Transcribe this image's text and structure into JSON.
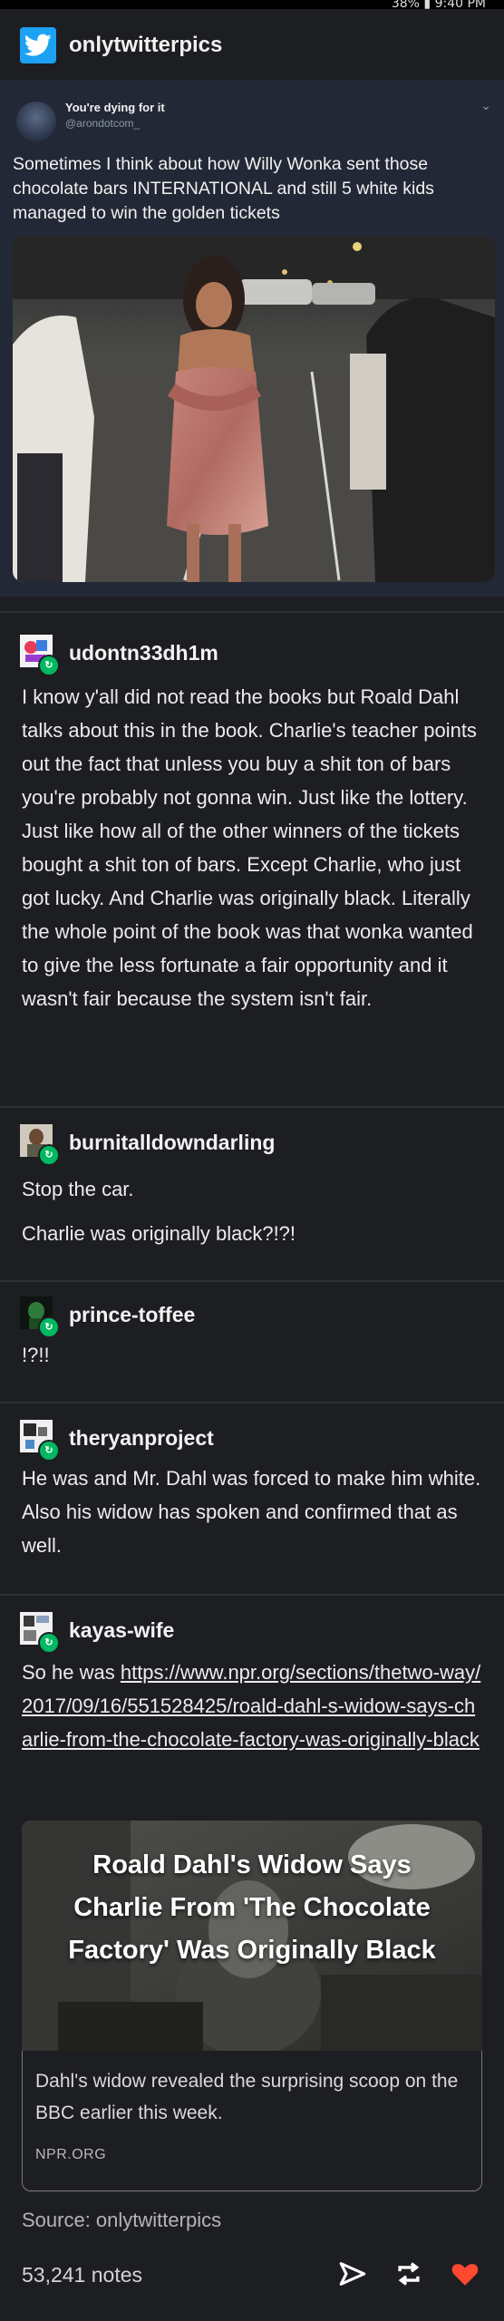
{
  "status_bar": {
    "text": "38% ▮ 9:40 PM"
  },
  "post_header": {
    "username": "onlytwitterpics"
  },
  "tweet": {
    "display_name": "You're dying for it",
    "handle": "@arondotcom_",
    "text": "Sometimes I think about how Willy Wonka sent those chocolate bars INTERNATIONAL and still 5 white kids managed to win the golden tickets"
  },
  "reblogs": [
    {
      "username": "udontn33dh1m",
      "paragraphs": [
        "I know y'all did not read the books but Roald Dahl  talks about this in the book. Charlie's teacher points out the fact that unless you buy a shit ton of bars you're probably not gonna win. Just like the lottery. Just like how all of the other winners of the tickets bought a shit ton of bars. Except Charlie, who just got lucky. And Charlie was originally black. Literally the whole point of the book was that wonka wanted to give the less fortunate a fair opportunity and it wasn't fair because the system isn't fair."
      ]
    },
    {
      "username": "burnitalldowndarling",
      "paragraphs": [
        "Stop the car.",
        "Charlie was originally black?!?!"
      ]
    },
    {
      "username": "prince-toffee",
      "paragraphs": [
        "!?!!"
      ]
    },
    {
      "username": "theryanproject",
      "paragraphs": [
        "He was and Mr. Dahl was forced to make him white. Also his widow has spoken and confirmed that as well."
      ]
    },
    {
      "username": "kayas-wife",
      "intro": "So he was ",
      "link": "https://www.npr.org/sections/thetwo-way/2017/09/16/551528425/roald-dahl-s-widow-says-charlie-from-the-chocolate-factory-was-originally-black"
    }
  ],
  "link_card": {
    "title": "Roald Dahl's Widow Says Charlie From 'The Chocolate Factory' Was Originally Black",
    "description": "Dahl's widow revealed the surprising scoop on the BBC earlier this week.",
    "domain": "NPR.ORG"
  },
  "footer": {
    "source": "Source: onlytwitterpics",
    "notes": "53,241 notes"
  },
  "colors": {
    "background": "#1d1e22",
    "tweet_bg": "#232836",
    "reblog_green": "#00b860",
    "twitter_blue": "#1da1f2",
    "like_red": "#ff4930"
  },
  "icons": [
    "twitter-bird-icon",
    "reblog-icon",
    "chevron-down-icon",
    "share-icon",
    "reblog-action-icon",
    "heart-icon"
  ]
}
